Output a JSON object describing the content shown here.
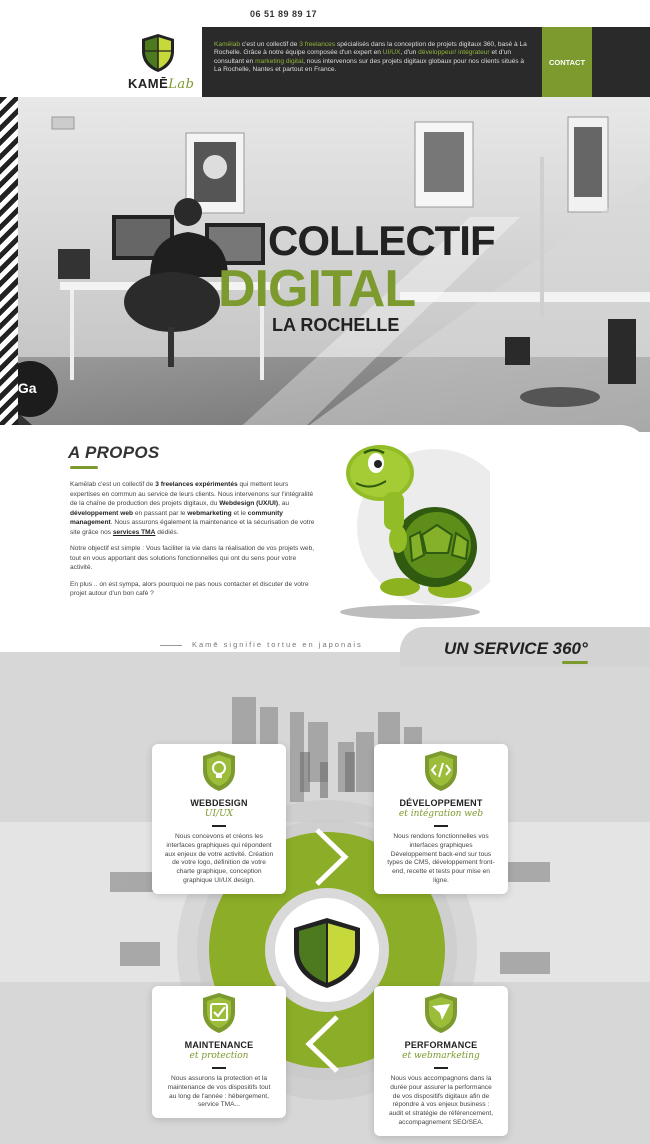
{
  "topbar": {
    "phone": "06 51 89 89 17"
  },
  "header": {
    "logo_main": "KAMĒ",
    "logo_lab": "Lab",
    "intro": [
      {
        "t": "Kamēlab",
        "hl": true
      },
      {
        "t": " c'est un collectif de ",
        "hl": false
      },
      {
        "t": "3 freelances",
        "hl": true
      },
      {
        "t": " spécialisés dans la conception de projets digitaux 360, basé à La Rochelle. Grâce à notre équipe composée d'un expert en ",
        "hl": false
      },
      {
        "t": "UI/UX",
        "hl": true
      },
      {
        "t": ", d'un ",
        "hl": false
      },
      {
        "t": "développeur/ intégrateur",
        "hl": true
      },
      {
        "t": " et d'un consultant en ",
        "hl": false
      },
      {
        "t": "marketing digital",
        "hl": true
      },
      {
        "t": ", nous intervenons sur des projets digitaux globaux pour nos clients situés à La Rochelle, Nantes et partout en France.",
        "hl": false
      }
    ],
    "contact_label": "CONTACT"
  },
  "hero": {
    "line1": "COLLECTIF",
    "line2": "DIGITAL",
    "line3": "LA ROCHELLE"
  },
  "apropos": {
    "title": "A PROPOS",
    "p1": [
      {
        "t": "Kamēlab c'est un collectif de ",
        "s": "n"
      },
      {
        "t": "3 freelances expérimentés",
        "s": "b"
      },
      {
        "t": " qui mettent leurs expertises en commun au service de leurs clients. Nous intervenons sur l'intégralité de la chaîne de production des projets digitaux, du ",
        "s": "n"
      },
      {
        "t": "Webdesign (UX/UI)",
        "s": "b"
      },
      {
        "t": ", au ",
        "s": "n"
      },
      {
        "t": "développement web",
        "s": "b"
      },
      {
        "t": " en passant par le ",
        "s": "n"
      },
      {
        "t": "webmarketing",
        "s": "b"
      },
      {
        "t": " et le ",
        "s": "n"
      },
      {
        "t": "community management",
        "s": "b"
      },
      {
        "t": ". Nous assurons également la maintenance et la sécurisation de votre site grâce nos ",
        "s": "n"
      },
      {
        "t": "services TMA",
        "s": "u"
      },
      {
        "t": " dédiés.",
        "s": "n"
      }
    ],
    "p2": "Notre objectif est simple : Vous faciliter la vie dans la réalisation de vos projets web, tout en vous apportant des solutions fonctionnelles qui ont du sens pour votre activité.",
    "p3": "En plus .. on est sympa, alors pourquoi ne pas nous contacter et discuter de votre projet autour d'un bon café ?"
  },
  "tagline": "Kamē signifie tortue en japonais",
  "service": {
    "title": "UN SERVICE 360°",
    "cards": [
      {
        "title": "WEBDESIGN",
        "subtitle": "UI/UX",
        "icon": "lightbulb-icon",
        "text": "Nous concevons et créons les interfaces graphiques qui répondent aux enjeux de votre activité. Création de votre logo, définition de votre charte graphique, conception graphique UI/UX design."
      },
      {
        "title": "DÉVELOPPEMENT",
        "subtitle": "et intégration web",
        "icon": "code-icon",
        "text": "Nous rendons fonctionnelles vos interfaces graphiques Développement back-end sur tous types de CMS, développement front-end, recette et tests pour mise en ligne."
      },
      {
        "title": "MAINTENANCE",
        "subtitle": "et protection",
        "icon": "check-icon",
        "text": "Nous assurons la protection et la maintenance de vos dispositifs tout au long de l'année : hébergement, service TMA..."
      },
      {
        "title": "PERFORMANCE",
        "subtitle": "et webmarketing",
        "icon": "send-icon",
        "text": "Nous vous accompagnons dans la durée pour assurer la performance de vos dispositifs digitaux afin de répondre à vos enjeux business : audit et stratégie de référencement, accompagnement SEO/SEA."
      }
    ]
  },
  "colors": {
    "accent": "#7c9a2e",
    "dark": "#2a2a2a",
    "light_gray": "#d7d7d7"
  }
}
